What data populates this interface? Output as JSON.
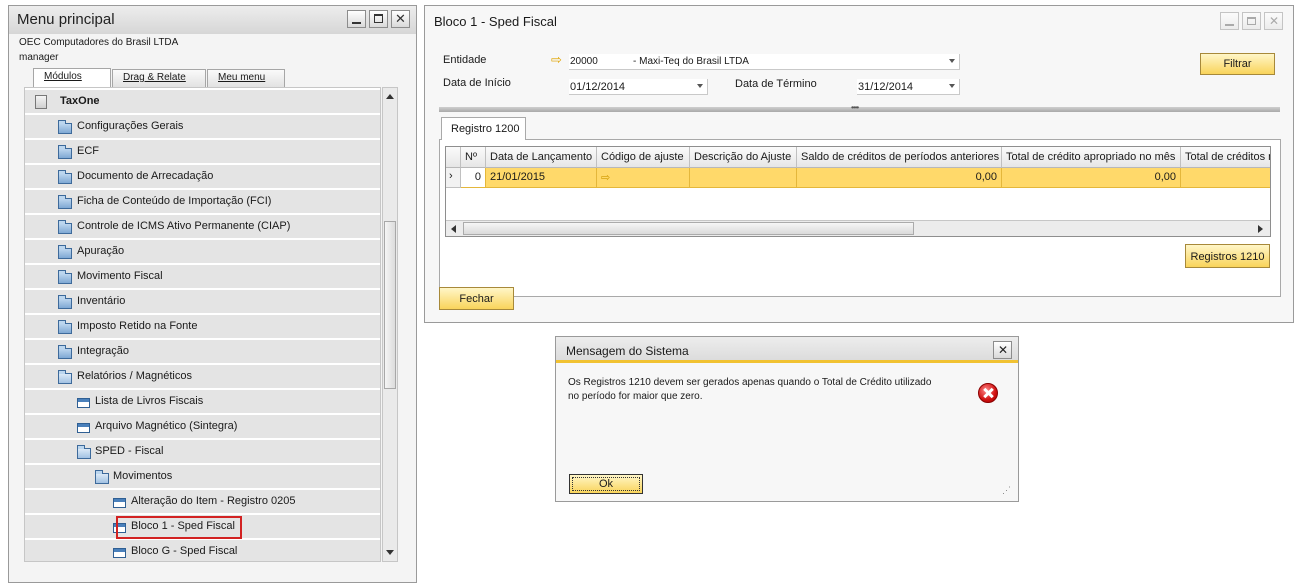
{
  "menu": {
    "title": "Menu principal",
    "company": "OEC Computadores do Brasil LTDA",
    "user": "manager",
    "tabs": [
      "Módulos",
      "Drag & Relate",
      "Meu menu"
    ],
    "items": [
      {
        "label": "TaxOne",
        "icon": "calculator-icon"
      },
      {
        "label": "Configurações Gerais",
        "icon": "folder-icon"
      },
      {
        "label": "ECF",
        "icon": "folder-icon"
      },
      {
        "label": "Documento de Arrecadação",
        "icon": "folder-icon"
      },
      {
        "label": "Ficha de Conteúdo de Importação (FCI)",
        "icon": "folder-icon"
      },
      {
        "label": "Controle de ICMS Ativo Permanente (CIAP)",
        "icon": "folder-icon"
      },
      {
        "label": "Apuração",
        "icon": "folder-icon"
      },
      {
        "label": "Movimento Fiscal",
        "icon": "folder-icon"
      },
      {
        "label": "Inventário",
        "icon": "folder-icon"
      },
      {
        "label": "Imposto Retido na Fonte",
        "icon": "folder-icon"
      },
      {
        "label": "Integração",
        "icon": "folder-icon"
      },
      {
        "label": "Relatórios / Magnéticos",
        "icon": "folder-open-icon"
      },
      {
        "label": "Lista de Livros Fiscais",
        "icon": "form-icon"
      },
      {
        "label": "Arquivo Magnético (Sintegra)",
        "icon": "form-icon"
      },
      {
        "label": "SPED - Fiscal",
        "icon": "folder-open-icon"
      },
      {
        "label": "Movimentos",
        "icon": "folder-open-icon"
      },
      {
        "label": "Alteração do Item - Registro 0205",
        "icon": "form-icon"
      },
      {
        "label": "Bloco 1 - Sped Fiscal",
        "icon": "form-icon"
      },
      {
        "label": "Bloco G - Sped Fiscal",
        "icon": "form-icon"
      }
    ]
  },
  "bloco": {
    "title": "Bloco 1 - Sped Fiscal",
    "entidade_label": "Entidade",
    "entidade_code": "20000",
    "entidade_name": "- Maxi-Teq do Brasil LTDA",
    "data_inicio_label": "Data de Início",
    "data_inicio": "01/12/2014",
    "data_termino_label": "Data de Término",
    "data_termino": "31/12/2014",
    "filtrar": "Filtrar",
    "tab": "Registro 1200",
    "columns": [
      "Nº",
      "Data de Lançamento",
      "Código de ajuste",
      "Descrição do Ajuste",
      "Saldo de créditos de períodos anteriores",
      "Total de crédito apropriado no mês",
      "Total de créditos r"
    ],
    "row": {
      "num": "0",
      "data": "21/01/2015",
      "codigo": "",
      "descricao": "",
      "saldo": "0,00",
      "total_apropriado": "0,00",
      "total_creditos": ""
    },
    "registros_button": "Registros 1210",
    "fechar": "Fechar"
  },
  "message": {
    "title": "Mensagem do Sistema",
    "text_line1": "Os Registros 1210 devem ser gerados apenas quando o Total de Crédito utilizado",
    "text_line2": "no período for maior que zero.",
    "ok": "Ok"
  },
  "colors": {
    "accent_yellow": "#ffd96a",
    "highlight_red": "#d22222",
    "folder_blue": "#7fa9d4"
  }
}
